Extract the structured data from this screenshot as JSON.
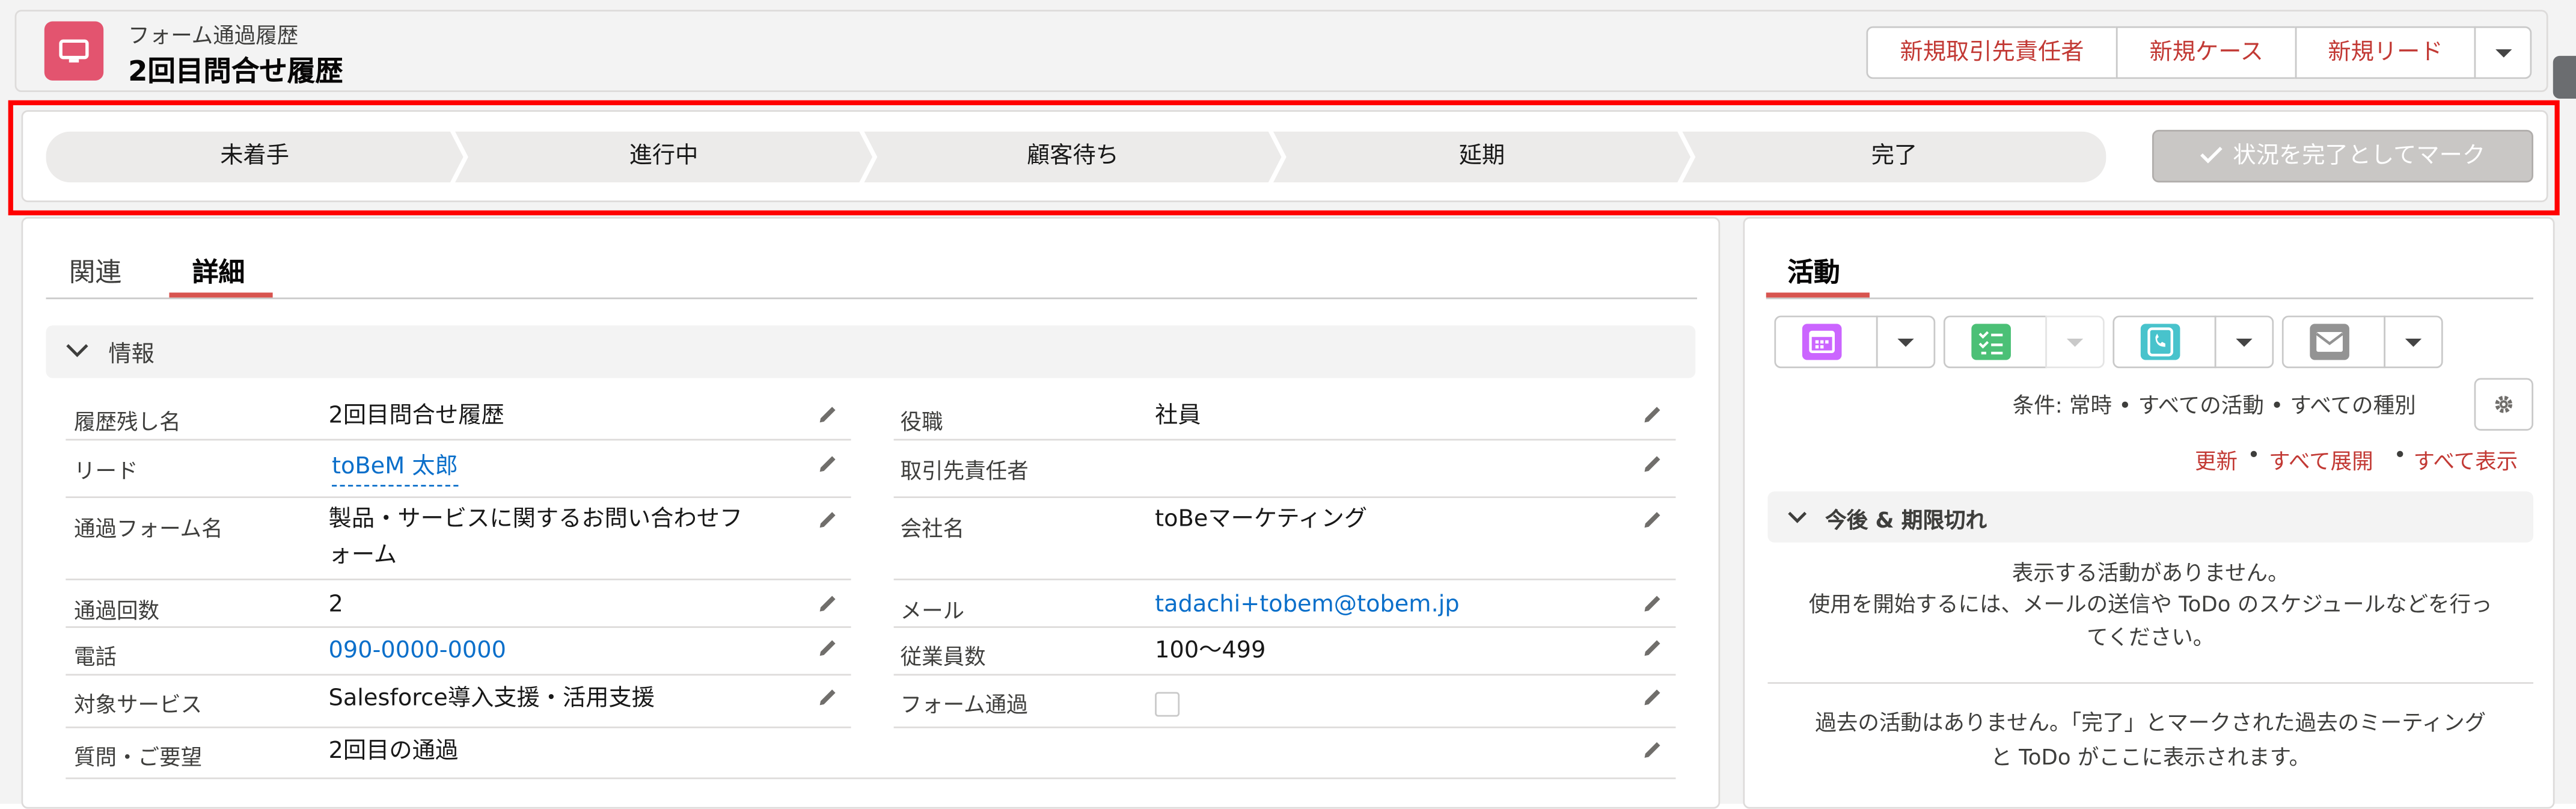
{
  "header": {
    "object_label": "フォーム通過履歴",
    "record_title": "2回目問合せ履歴",
    "buttons": [
      "新規取引先責任者",
      "新規ケース",
      "新規リード"
    ],
    "more_icon": "chevron-down-icon"
  },
  "path": {
    "stages": [
      "未着手",
      "進行中",
      "顧客待ち",
      "延期",
      "完了"
    ],
    "mark_complete_label": "状況を完了としてマーク",
    "mark_complete_icon": "check-icon"
  },
  "tabs": {
    "related": "関連",
    "detail": "詳細"
  },
  "section": {
    "title": "情報"
  },
  "fields": {
    "left": [
      {
        "label": "履歴残し名",
        "value": "2回目問合せ履歴"
      },
      {
        "label": "リード",
        "value": "toBeM 太郎"
      },
      {
        "label": "通過フォーム名",
        "value_line1": "製品・サービスに関するお問い合わせフ",
        "value_line2": "ォーム"
      },
      {
        "label": "通過回数",
        "value": "2"
      },
      {
        "label": "電話",
        "value": "090-0000-0000"
      },
      {
        "label": "対象サービス",
        "value": "Salesforce導入支援・活用支援"
      }
    ],
    "right": [
      {
        "label": "役職",
        "value": "社員"
      },
      {
        "label": "取引先責任者",
        "value": ""
      },
      {
        "label": "会社名",
        "value": "toBeマーケティング"
      },
      {
        "label": "メール",
        "value": "tadachi+tobem@tobem.jp"
      },
      {
        "label": "従業員数",
        "value": "100〜499"
      },
      {
        "label": "フォーム通過",
        "value": ""
      }
    ],
    "full": {
      "label": "質問・ご要望",
      "value": "2回目の通過"
    }
  },
  "activity": {
    "tab": "活動",
    "filter": "条件: 常時 • すべての活動 • すべての種別",
    "links": {
      "refresh": "更新",
      "expand": "すべて展開",
      "show_all": "すべて表示"
    },
    "dot": "•",
    "upcoming_title": "今後 & 期限切れ",
    "empty_line1": "表示する活動がありません。",
    "empty_line2": "使用を開始するには、メールの送信や ToDo のスケジュールなどを行っ",
    "empty_line3": "てください。",
    "past_line1": "過去の活動はありません。「完了」とマークされた過去のミーティング",
    "past_line2": "と ToDo がここに表示されます。",
    "buttons": [
      {
        "icon": "calendar-icon",
        "color": "#cb65ff"
      },
      {
        "icon": "task-icon",
        "color": "#4bc076"
      },
      {
        "icon": "phone-icon",
        "color": "#48c3cc"
      },
      {
        "icon": "email-icon",
        "color": "#939393"
      }
    ]
  },
  "colors": {
    "accent_red": "#c23934",
    "link_blue": "#0b6fca",
    "record_icon": "#e3546f",
    "highlight_outline": "#ff0000"
  }
}
